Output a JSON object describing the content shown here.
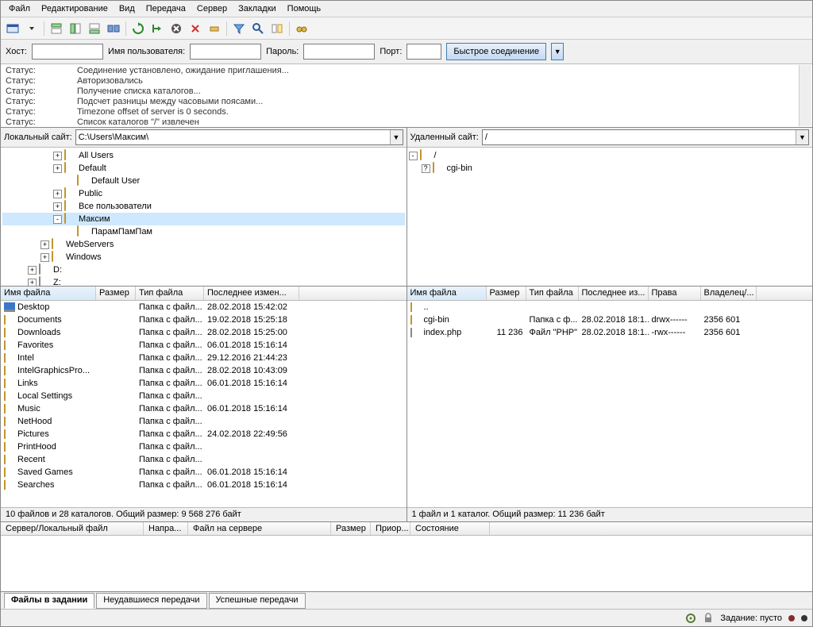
{
  "menu": [
    "Файл",
    "Редактирование",
    "Вид",
    "Передача",
    "Сервер",
    "Закладки",
    "Помощь"
  ],
  "quickconnect": {
    "host_label": "Хост:",
    "user_label": "Имя пользователя:",
    "pass_label": "Пароль:",
    "port_label": "Порт:",
    "button": "Быстрое соединение"
  },
  "log": [
    {
      "k": "Статус:",
      "v": "Соединение установлено, ожидание приглашения..."
    },
    {
      "k": "Статус:",
      "v": "Авторизовались"
    },
    {
      "k": "Статус:",
      "v": "Получение списка каталогов..."
    },
    {
      "k": "Статус:",
      "v": "Подсчет разницы между часовыми поясами..."
    },
    {
      "k": "Статус:",
      "v": "Timezone offset of server is 0 seconds."
    },
    {
      "k": "Статус:",
      "v": "Список каталогов \"/\" извлечен"
    }
  ],
  "local": {
    "label": "Локальный сайт:",
    "path": "C:\\Users\\Максим\\",
    "tree": [
      {
        "indent": 4,
        "exp": "+",
        "icon": "folder",
        "name": "All Users"
      },
      {
        "indent": 4,
        "exp": "+",
        "icon": "folder",
        "name": "Default"
      },
      {
        "indent": 5,
        "exp": "",
        "icon": "folder",
        "name": "Default User"
      },
      {
        "indent": 4,
        "exp": "+",
        "icon": "folder",
        "name": "Public"
      },
      {
        "indent": 4,
        "exp": "+",
        "icon": "folder",
        "name": "Все пользователи"
      },
      {
        "indent": 4,
        "exp": "-",
        "icon": "folder",
        "name": "Максим",
        "sel": true
      },
      {
        "indent": 5,
        "exp": "",
        "icon": "folder",
        "name": "ПарамПамПам"
      },
      {
        "indent": 3,
        "exp": "+",
        "icon": "folder",
        "name": "WebServers"
      },
      {
        "indent": 3,
        "exp": "+",
        "icon": "folder",
        "name": "Windows"
      },
      {
        "indent": 2,
        "exp": "+",
        "icon": "drive",
        "name": "D:"
      },
      {
        "indent": 2,
        "exp": "+",
        "icon": "drive",
        "name": "Z:"
      }
    ],
    "columns": [
      {
        "label": "Имя файла",
        "w": 120,
        "sorted": true
      },
      {
        "label": "Размер",
        "w": 50
      },
      {
        "label": "Тип файла",
        "w": 86
      },
      {
        "label": "Последнее измен...",
        "w": 120
      }
    ],
    "files": [
      {
        "icon": "desktop",
        "name": "Desktop",
        "size": "",
        "type": "Папка с файл...",
        "date": "28.02.2018 15:42:02"
      },
      {
        "icon": "folder",
        "name": "Documents",
        "size": "",
        "type": "Папка с файл...",
        "date": "19.02.2018 15:25:18"
      },
      {
        "icon": "folder",
        "name": "Downloads",
        "size": "",
        "type": "Папка с файл...",
        "date": "28.02.2018 15:25:00"
      },
      {
        "icon": "folder",
        "name": "Favorites",
        "size": "",
        "type": "Папка с файл...",
        "date": "06.01.2018 15:16:14"
      },
      {
        "icon": "folder",
        "name": "Intel",
        "size": "",
        "type": "Папка с файл...",
        "date": "29.12.2016 21:44:23"
      },
      {
        "icon": "folder",
        "name": "IntelGraphicsPro...",
        "size": "",
        "type": "Папка с файл...",
        "date": "28.02.2018 10:43:09"
      },
      {
        "icon": "folder",
        "name": "Links",
        "size": "",
        "type": "Папка с файл...",
        "date": "06.01.2018 15:16:14"
      },
      {
        "icon": "folder",
        "name": "Local Settings",
        "size": "",
        "type": "Папка с файл...",
        "date": ""
      },
      {
        "icon": "folder",
        "name": "Music",
        "size": "",
        "type": "Папка с файл...",
        "date": "06.01.2018 15:16:14"
      },
      {
        "icon": "folder",
        "name": "NetHood",
        "size": "",
        "type": "Папка с файл...",
        "date": ""
      },
      {
        "icon": "folder",
        "name": "Pictures",
        "size": "",
        "type": "Папка с файл...",
        "date": "24.02.2018 22:49:56"
      },
      {
        "icon": "folder",
        "name": "PrintHood",
        "size": "",
        "type": "Папка с файл...",
        "date": ""
      },
      {
        "icon": "folder",
        "name": "Recent",
        "size": "",
        "type": "Папка с файл...",
        "date": ""
      },
      {
        "icon": "folder",
        "name": "Saved Games",
        "size": "",
        "type": "Папка с файл...",
        "date": "06.01.2018 15:16:14"
      },
      {
        "icon": "folder",
        "name": "Searches",
        "size": "",
        "type": "Папка с файл...",
        "date": "06.01.2018 15:16:14"
      }
    ],
    "status": "10 файлов и 28 каталогов. Общий размер: 9 568 276 байт"
  },
  "remote": {
    "label": "Удаленный сайт:",
    "path": "/",
    "tree": [
      {
        "indent": 0,
        "exp": "-",
        "icon": "folder",
        "name": "/"
      },
      {
        "indent": 1,
        "exp": "?",
        "icon": "folder",
        "name": "cgi-bin"
      }
    ],
    "columns": [
      {
        "label": "Имя файла",
        "w": 100,
        "sorted": true
      },
      {
        "label": "Размер",
        "w": 50
      },
      {
        "label": "Тип файла",
        "w": 66
      },
      {
        "label": "Последнее из...",
        "w": 88
      },
      {
        "label": "Права",
        "w": 66
      },
      {
        "label": "Владелец/...",
        "w": 70
      }
    ],
    "files": [
      {
        "icon": "up",
        "name": "..",
        "size": "",
        "type": "",
        "date": "",
        "perms": "",
        "owner": ""
      },
      {
        "icon": "folder",
        "name": "cgi-bin",
        "size": "",
        "type": "Папка с ф...",
        "date": "28.02.2018 18:1...",
        "perms": "drwx------",
        "owner": "2356 601"
      },
      {
        "icon": "file",
        "name": "index.php",
        "size": "11 236",
        "type": "Файл \"PHP\"",
        "date": "28.02.2018 18:1...",
        "perms": "-rwx------",
        "owner": "2356 601"
      }
    ],
    "status": "1 файл и 1 каталог. Общий размер: 11 236 байт"
  },
  "queue": {
    "columns": [
      "Сервер/Локальный файл",
      "Напра...",
      "Файл на сервере",
      "Размер",
      "Приор...",
      "Состояние"
    ]
  },
  "tabs": [
    "Файлы в задании",
    "Неудавшиеся передачи",
    "Успешные передачи"
  ],
  "bottom": {
    "queue_label": "Задание: пусто"
  }
}
